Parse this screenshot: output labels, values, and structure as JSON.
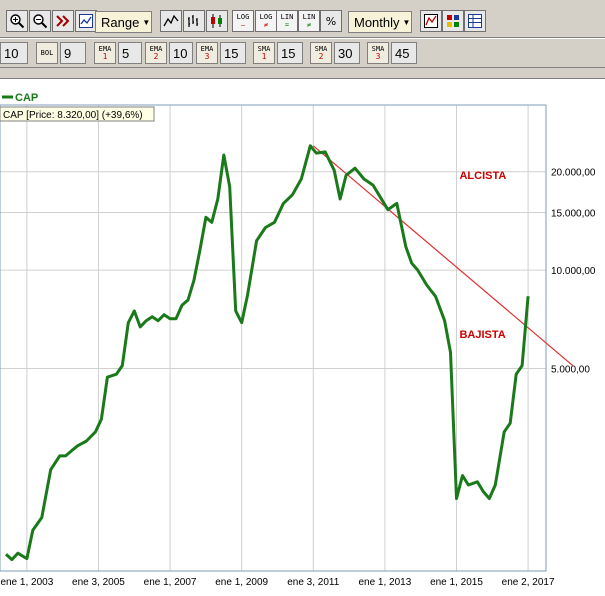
{
  "toolbar": {
    "range_label": "Range",
    "period_label": "Monthly",
    "log_top": "LOG",
    "lin_top": "LIN",
    "pct_label": "%",
    "icons": [
      "zoom-in-icon",
      "zoom-out-icon",
      "fast-forward-icon",
      "fit-icon",
      "line-chart-icon",
      "bar-chart-icon",
      "candlestick-icon",
      "log-scale-icon",
      "log-scale-icon",
      "linear-scale-icon",
      "linear-scale-icon",
      "percent-icon",
      "chart-settings-icon",
      "colors-icon",
      "table-icon"
    ]
  },
  "indicators": {
    "first_value": "10",
    "bol_label": "BOL",
    "bol_value": "9",
    "ema_label": "EMA",
    "ema": [
      {
        "n": "1",
        "value": "5"
      },
      {
        "n": "2",
        "value": "10"
      },
      {
        "n": "3",
        "value": "15"
      }
    ],
    "sma_label": "SMA",
    "sma": [
      {
        "n": "1",
        "value": "15"
      },
      {
        "n": "2",
        "value": "30"
      },
      {
        "n": "3",
        "value": "45"
      }
    ]
  },
  "legend": {
    "series_name": "CAP",
    "price_text": "CAP [Price: 8.320,00] (+39,6%)"
  },
  "colors": {
    "series": "#1a7a1a",
    "trendline": "#e03030",
    "annotation": "#cc0000",
    "grid": "#d0d0d0",
    "toolbar": "#d4d0c8"
  },
  "chart_data": {
    "type": "line",
    "title": "",
    "series": [
      {
        "name": "CAP",
        "values": [
          [
            "2002-06",
            1350
          ],
          [
            "2002-08",
            1300
          ],
          [
            "2002-10",
            1360
          ],
          [
            "2003-01",
            1310
          ],
          [
            "2003-03",
            1600
          ],
          [
            "2003-06",
            1750
          ],
          [
            "2003-09",
            2450
          ],
          [
            "2003-12",
            2700
          ],
          [
            "2004-02",
            2700
          ],
          [
            "2004-04",
            2800
          ],
          [
            "2004-06",
            2900
          ],
          [
            "2004-09",
            3000
          ],
          [
            "2004-12",
            3200
          ],
          [
            "2005-02",
            3500
          ],
          [
            "2005-04",
            4700
          ],
          [
            "2005-07",
            4800
          ],
          [
            "2005-09",
            5100
          ],
          [
            "2005-11",
            6900
          ],
          [
            "2006-01",
            7500
          ],
          [
            "2006-03",
            6700
          ],
          [
            "2006-05",
            7000
          ],
          [
            "2006-07",
            7200
          ],
          [
            "2006-09",
            7000
          ],
          [
            "2006-11",
            7300
          ],
          [
            "2007-01",
            7100
          ],
          [
            "2007-03",
            7100
          ],
          [
            "2007-05",
            7800
          ],
          [
            "2007-07",
            8100
          ],
          [
            "2007-09",
            9300
          ],
          [
            "2007-11",
            11500
          ],
          [
            "2008-01",
            14500
          ],
          [
            "2008-03",
            14000
          ],
          [
            "2008-05",
            16500
          ],
          [
            "2008-07",
            22500
          ],
          [
            "2008-09",
            18000
          ],
          [
            "2008-11",
            7500
          ],
          [
            "2009-01",
            6900
          ],
          [
            "2009-03",
            8400
          ],
          [
            "2009-06",
            12300
          ],
          [
            "2009-09",
            13500
          ],
          [
            "2009-12",
            14000
          ],
          [
            "2010-03",
            16000
          ],
          [
            "2010-06",
            17000
          ],
          [
            "2010-09",
            19000
          ],
          [
            "2010-12",
            24000
          ],
          [
            "2011-02",
            22800
          ],
          [
            "2011-05",
            23000
          ],
          [
            "2011-08",
            20200
          ],
          [
            "2011-10",
            16500
          ],
          [
            "2011-12",
            19500
          ],
          [
            "2012-03",
            20500
          ],
          [
            "2012-06",
            19000
          ],
          [
            "2012-09",
            18200
          ],
          [
            "2012-11",
            17000
          ],
          [
            "2013-02",
            15300
          ],
          [
            "2013-05",
            16000
          ],
          [
            "2013-08",
            11800
          ],
          [
            "2013-10",
            10500
          ],
          [
            "2013-12",
            10000
          ],
          [
            "2014-03",
            9000
          ],
          [
            "2014-06",
            8300
          ],
          [
            "2014-09",
            7000
          ],
          [
            "2014-11",
            5600
          ],
          [
            "2015-01",
            2000
          ],
          [
            "2015-03",
            2350
          ],
          [
            "2015-05",
            2200
          ],
          [
            "2015-08",
            2250
          ],
          [
            "2015-10",
            2100
          ],
          [
            "2015-12",
            2000
          ],
          [
            "2016-02",
            2200
          ],
          [
            "2016-05",
            3200
          ],
          [
            "2016-07",
            3400
          ],
          [
            "2016-09",
            4800
          ],
          [
            "2016-11",
            5100
          ],
          [
            "2017-01",
            8320
          ]
        ]
      }
    ],
    "x_tick_labels": [
      "ene 1, 2003",
      "ene 3, 2005",
      "ene 1, 2007",
      "ene 1, 2009",
      "ene 3, 2011",
      "ene 1, 2013",
      "ene 1, 2015",
      "ene 2, 2017"
    ],
    "x_ticks": [
      "2003-01",
      "2005-01",
      "2007-01",
      "2009-01",
      "2011-01",
      "2013-01",
      "2015-01",
      "2017-01"
    ],
    "y_tick_labels": [
      "20.000,00",
      "15.000,00",
      "10.000,00",
      "5.000,00"
    ],
    "y_ticks": [
      20000,
      15000,
      10000,
      5000
    ],
    "y_scale": "log",
    "xlim": [
      "2002-04",
      "2017-07"
    ],
    "ylim": [
      1200,
      32000
    ],
    "trendline": {
      "from": [
        "2011-01",
        24000
      ],
      "to": [
        "2018-04",
        5100
      ]
    },
    "annotations": [
      {
        "text": "ALCISTA",
        "x": "2015-02",
        "y": 19000
      },
      {
        "text": "BAJISTA",
        "x": "2015-02",
        "y": 6200
      }
    ],
    "grid": true,
    "legend_position": "top-left"
  }
}
